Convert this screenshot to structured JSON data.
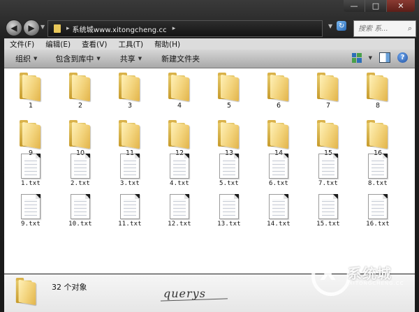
{
  "window": {
    "controls": {
      "minimize": "—",
      "maximize": "□",
      "close": "✕"
    }
  },
  "nav": {
    "back_glyph": "◀",
    "forward_glyph": "▶",
    "history_dropdown": "▼",
    "address_path": "系统城www.xitongcheng.cc",
    "address_separator": "▸",
    "address_dropdown": "▼",
    "refresh_glyph": "↻",
    "search_placeholder": "搜索 系...",
    "search_glyph": "🔍"
  },
  "menu": [
    "文件(F)",
    "编辑(E)",
    "查看(V)",
    "工具(T)",
    "帮助(H)"
  ],
  "toolbar": {
    "organize": "组织",
    "include_in_library": "包含到库中",
    "share": "共享",
    "new_folder": "新建文件夹",
    "help_glyph": "?"
  },
  "items": {
    "folders": [
      "1",
      "2",
      "3",
      "4",
      "5",
      "6",
      "7",
      "8",
      "9",
      "10",
      "11",
      "12",
      "13",
      "14",
      "15",
      "16"
    ],
    "files": [
      "1.txt",
      "2.txt",
      "3.txt",
      "4.txt",
      "5.txt",
      "6.txt",
      "7.txt",
      "8.txt",
      "9.txt",
      "10.txt",
      "11.txt",
      "12.txt",
      "13.txt",
      "14.txt",
      "15.txt",
      "16.txt"
    ]
  },
  "details": {
    "count_label": "32 个对象"
  },
  "signature": "querys",
  "watermark": {
    "glyph": "X",
    "text": "系统城",
    "sub": "XITONGCHENG.CC"
  },
  "colors": {
    "folder": "#e9c85a",
    "chrome_dark": "#1c1c1c",
    "toolbar": "#c4c4c4",
    "accent_blue": "#2d6fb8"
  }
}
